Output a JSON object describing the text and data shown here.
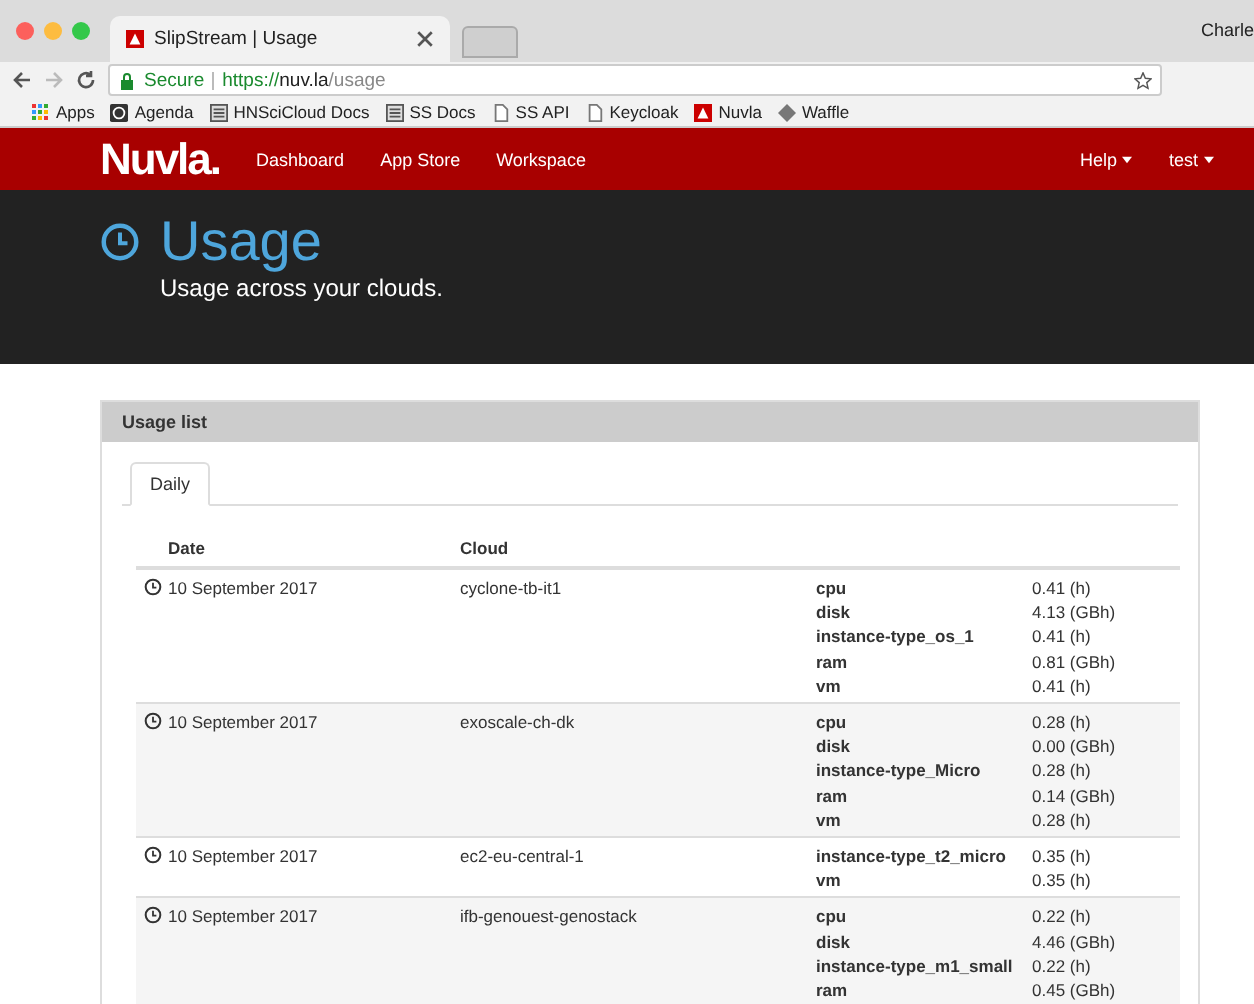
{
  "browser": {
    "tab_title": "SlipStream | Usage",
    "user_label": "Charle",
    "url": {
      "secure_label": "Secure",
      "scheme": "https://",
      "host": "nuv.la",
      "path": "/usage"
    },
    "bookmarks": [
      {
        "kind": "apps",
        "label": "Apps"
      },
      {
        "kind": "agenda",
        "label": "Agenda"
      },
      {
        "kind": "doc",
        "label": "HNSciCloud Docs"
      },
      {
        "kind": "doc",
        "label": "SS Docs"
      },
      {
        "kind": "page",
        "label": "SS API"
      },
      {
        "kind": "page",
        "label": "Keycloak"
      },
      {
        "kind": "logo",
        "label": "Nuvla"
      },
      {
        "kind": "diamond",
        "label": "Waffle"
      }
    ]
  },
  "nav": {
    "logo": "Nuvla.",
    "links": [
      "Dashboard",
      "App Store",
      "Workspace"
    ],
    "menus": [
      "Help",
      "test"
    ]
  },
  "header": {
    "title": "Usage",
    "subtitle": "Usage across your clouds."
  },
  "panel": {
    "title": "Usage list",
    "tabs": [
      {
        "label": "Daily",
        "selected": true
      }
    ],
    "table": {
      "columns": [
        "Date",
        "Cloud"
      ],
      "rows": [
        {
          "date": "10 September 2017",
          "cloud": "cyclone-tb-it1",
          "metrics": [
            {
              "name": "cpu",
              "value": "0.41 (h)"
            },
            {
              "name": "disk",
              "value": "4.13 (GBh)"
            },
            {
              "name": "instance-type_os_1",
              "value": "0.41 (h)"
            },
            {
              "name": "ram",
              "value": "0.81 (GBh)"
            },
            {
              "name": "vm",
              "value": "0.41 (h)"
            }
          ]
        },
        {
          "date": "10 September 2017",
          "cloud": "exoscale-ch-dk",
          "metrics": [
            {
              "name": "cpu",
              "value": "0.28 (h)"
            },
            {
              "name": "disk",
              "value": "0.00 (GBh)"
            },
            {
              "name": "instance-type_Micro",
              "value": "0.28 (h)"
            },
            {
              "name": "ram",
              "value": "0.14 (GBh)"
            },
            {
              "name": "vm",
              "value": "0.28 (h)"
            }
          ]
        },
        {
          "date": "10 September 2017",
          "cloud": "ec2-eu-central-1",
          "metrics": [
            {
              "name": "instance-type_t2_micro",
              "value": "0.35 (h)"
            },
            {
              "name": "vm",
              "value": "0.35 (h)"
            }
          ]
        },
        {
          "date": "10 September 2017",
          "cloud": "ifb-genouest-genostack",
          "metrics": [
            {
              "name": "cpu",
              "value": "0.22 (h)"
            },
            {
              "name": "disk",
              "value": "4.46 (GBh)"
            },
            {
              "name": "instance-type_m1_small",
              "value": "0.22 (h)"
            },
            {
              "name": "ram",
              "value": "0.45 (GBh)"
            }
          ]
        }
      ]
    }
  }
}
